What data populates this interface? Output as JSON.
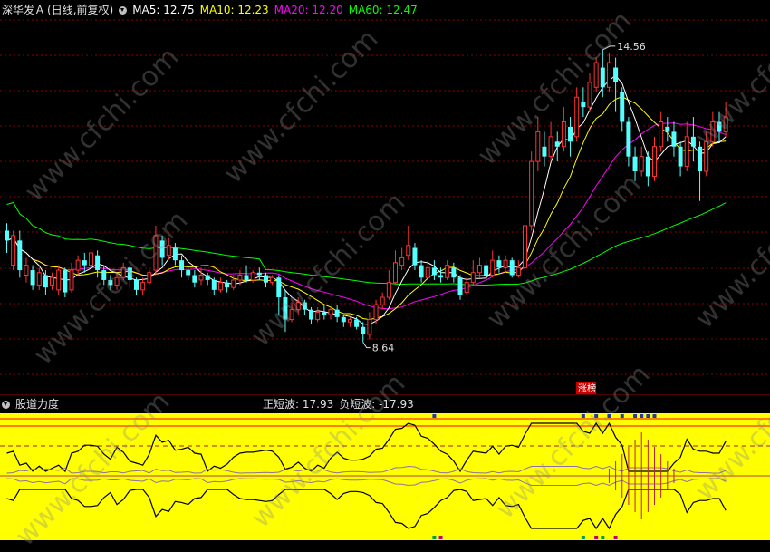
{
  "main_header": {
    "stock_name": "深华发Ａ",
    "period": "(日线,前复权)",
    "ma5": "MA5: 12.75",
    "ma10": "MA10: 12.23",
    "ma20": "MA20: 12.20",
    "ma60": "MA60: 12.47"
  },
  "price_annotations": {
    "high": "14.56",
    "low": "8.64",
    "badge": "涨榜"
  },
  "sub_header": {
    "name": "股道力度",
    "pos_wave": "正短波: 17.93",
    "neg_wave": "负短波: -17.93"
  },
  "watermark": "www.cfchi.com",
  "colors": {
    "background": "#000000",
    "up_candle": "#ff3232",
    "down_candle": "#54ffff",
    "ma5": "#ffffff",
    "ma10": "#ffff00",
    "ma20": "#ff00ff",
    "ma60": "#00ff00",
    "grid": "#8b0000",
    "sub_background": "#ffff00"
  },
  "chart_data": {
    "type": "candlestick",
    "title": "深华发Ａ (日线,前复权)",
    "price_range": [
      7.9,
      15.2
    ],
    "marked_high": 14.56,
    "marked_low": 8.64,
    "candles": [
      [
        10.9,
        10.7,
        11.05,
        10.45
      ],
      [
        10.2,
        10.8,
        10.9,
        10.1
      ],
      [
        10.7,
        10.1,
        10.9,
        9.95
      ],
      [
        10.0,
        10.2,
        10.35,
        9.85
      ],
      [
        10.1,
        9.8,
        10.2,
        9.7
      ],
      [
        9.8,
        10.05,
        10.15,
        9.7
      ],
      [
        10.0,
        9.75,
        10.1,
        9.6
      ],
      [
        9.8,
        9.95,
        10.05,
        9.7
      ],
      [
        9.7,
        10.1,
        10.2,
        9.6
      ],
      [
        10.1,
        9.65,
        10.15,
        9.55
      ],
      [
        9.7,
        10.1,
        10.25,
        9.65
      ],
      [
        10.1,
        10.3,
        10.4,
        10.0
      ],
      [
        10.3,
        10.2,
        10.45,
        10.05
      ],
      [
        10.2,
        10.45,
        10.55,
        10.15
      ],
      [
        10.4,
        10.1,
        10.5,
        9.95
      ],
      [
        10.1,
        9.9,
        10.2,
        9.8
      ],
      [
        9.9,
        9.8,
        10.0,
        9.7
      ],
      [
        9.8,
        9.95,
        10.05,
        9.7
      ],
      [
        9.95,
        10.15,
        10.25,
        9.9
      ],
      [
        10.15,
        9.9,
        10.2,
        9.75
      ],
      [
        9.9,
        9.7,
        9.95,
        9.6
      ],
      [
        9.7,
        9.85,
        9.95,
        9.6
      ],
      [
        9.85,
        10.05,
        10.1,
        9.8
      ],
      [
        10.1,
        10.8,
        11.0,
        10.0
      ],
      [
        10.7,
        10.35,
        10.8,
        10.2
      ],
      [
        10.4,
        10.6,
        10.75,
        10.3
      ],
      [
        10.55,
        10.3,
        10.65,
        10.2
      ],
      [
        10.3,
        10.1,
        10.4,
        9.95
      ],
      [
        10.1,
        10.0,
        10.2,
        9.9
      ],
      [
        10.0,
        9.85,
        10.1,
        9.75
      ],
      [
        9.9,
        10.0,
        10.15,
        9.8
      ],
      [
        10.0,
        9.9,
        10.05,
        9.8
      ],
      [
        9.9,
        9.7,
        9.95,
        9.6
      ],
      [
        9.7,
        9.85,
        9.95,
        9.65
      ],
      [
        9.85,
        9.75,
        9.9,
        9.65
      ],
      [
        9.75,
        9.9,
        10.0,
        9.7
      ],
      [
        9.9,
        10.0,
        10.1,
        9.8
      ],
      [
        10.0,
        9.9,
        10.2,
        9.85
      ],
      [
        9.9,
        10.05,
        10.1,
        9.85
      ],
      [
        10.05,
        10.0,
        10.15,
        9.9
      ],
      [
        10.0,
        9.85,
        10.05,
        9.75
      ],
      [
        9.85,
        9.95,
        10.0,
        9.8
      ],
      [
        9.95,
        9.55,
        10.0,
        9.2
      ],
      [
        9.55,
        9.1,
        9.7,
        8.85
      ],
      [
        9.1,
        9.3,
        9.45,
        9.05
      ],
      [
        9.3,
        9.45,
        9.55,
        9.2
      ],
      [
        9.45,
        9.3,
        9.5,
        9.2
      ],
      [
        9.3,
        9.1,
        9.35,
        9.0
      ],
      [
        9.1,
        9.25,
        9.35,
        9.05
      ],
      [
        9.25,
        9.2,
        9.4,
        9.1
      ],
      [
        9.2,
        9.3,
        9.35,
        9.1
      ],
      [
        9.3,
        9.15,
        9.4,
        9.05
      ],
      [
        9.15,
        9.05,
        9.2,
        8.95
      ],
      [
        9.05,
        9.1,
        9.15,
        8.95
      ],
      [
        9.1,
        8.95,
        9.15,
        8.9
      ],
      [
        8.95,
        8.8,
        9.05,
        8.64
      ],
      [
        8.8,
        9.1,
        9.25,
        8.7
      ],
      [
        9.1,
        9.4,
        9.5,
        9.0
      ],
      [
        9.4,
        9.55,
        9.65,
        9.3
      ],
      [
        9.55,
        9.85,
        10.1,
        9.5
      ],
      [
        9.85,
        10.25,
        10.5,
        9.8
      ],
      [
        10.2,
        10.35,
        10.55,
        10.1
      ],
      [
        10.4,
        10.6,
        11.0,
        10.3
      ],
      [
        10.55,
        10.2,
        10.65,
        10.1
      ],
      [
        10.2,
        9.95,
        10.3,
        9.85
      ],
      [
        9.95,
        10.15,
        10.3,
        9.9
      ],
      [
        10.15,
        10.0,
        10.3,
        9.9
      ],
      [
        10.0,
        9.95,
        10.15,
        9.85
      ],
      [
        9.95,
        10.2,
        10.3,
        9.9
      ],
      [
        10.15,
        9.95,
        10.25,
        9.85
      ],
      [
        9.95,
        9.6,
        10.0,
        9.5
      ],
      [
        9.65,
        9.85,
        9.95,
        9.6
      ],
      [
        9.85,
        10.05,
        10.3,
        9.8
      ],
      [
        10.05,
        10.2,
        10.35,
        9.95
      ],
      [
        10.2,
        10.0,
        10.3,
        9.9
      ],
      [
        10.0,
        10.3,
        10.5,
        9.95
      ],
      [
        10.3,
        10.15,
        10.4,
        10.05
      ],
      [
        10.15,
        10.3,
        10.4,
        10.05
      ],
      [
        10.3,
        10.0,
        10.35,
        9.95
      ],
      [
        10.0,
        10.15,
        10.3,
        9.95
      ],
      [
        10.15,
        11.0,
        11.2,
        10.1
      ],
      [
        11.0,
        12.3,
        12.5,
        10.9
      ],
      [
        12.3,
        12.9,
        13.2,
        12.1
      ],
      [
        12.6,
        12.4,
        12.9,
        12.2
      ],
      [
        12.4,
        12.8,
        13.1,
        12.3
      ],
      [
        12.7,
        12.6,
        12.9,
        12.3
      ],
      [
        12.6,
        13.1,
        13.4,
        12.5
      ],
      [
        13.0,
        12.7,
        13.2,
        12.4
      ],
      [
        12.8,
        13.6,
        13.8,
        12.7
      ],
      [
        13.5,
        13.4,
        13.8,
        13.2
      ],
      [
        13.4,
        13.9,
        14.1,
        13.3
      ],
      [
        13.8,
        14.3,
        14.4,
        13.7
      ],
      [
        14.2,
        13.8,
        14.56,
        13.6
      ],
      [
        13.8,
        14.3,
        14.5,
        13.7
      ],
      [
        14.2,
        13.9,
        14.4,
        13.3
      ],
      [
        13.7,
        13.1,
        13.8,
        12.9
      ],
      [
        13.1,
        12.4,
        13.2,
        12.2
      ],
      [
        12.4,
        12.1,
        12.6,
        11.9
      ],
      [
        12.1,
        12.4,
        12.6,
        12.0
      ],
      [
        12.4,
        12.0,
        12.5,
        11.8
      ],
      [
        12.0,
        12.6,
        12.8,
        11.9
      ],
      [
        12.6,
        13.1,
        13.3,
        12.5
      ],
      [
        13.0,
        12.9,
        13.2,
        12.7
      ],
      [
        12.9,
        12.6,
        13.1,
        12.4
      ],
      [
        12.6,
        12.2,
        12.7,
        12.0
      ],
      [
        12.2,
        12.8,
        13.1,
        12.1
      ],
      [
        12.8,
        12.6,
        13.2,
        12.3
      ],
      [
        12.6,
        12.1,
        12.7,
        11.5
      ],
      [
        12.1,
        12.7,
        12.9,
        12.0
      ],
      [
        12.7,
        13.1,
        13.3,
        12.6
      ],
      [
        13.1,
        12.9,
        13.3,
        12.7
      ],
      [
        12.9,
        13.2,
        13.5,
        12.8
      ]
    ],
    "ma_labels": [
      "MA5",
      "MA10",
      "MA20",
      "MA60"
    ],
    "sub_indicator": {
      "name": "股道力度",
      "positive_wave": 17.93,
      "negative_wave": -17.93
    }
  }
}
